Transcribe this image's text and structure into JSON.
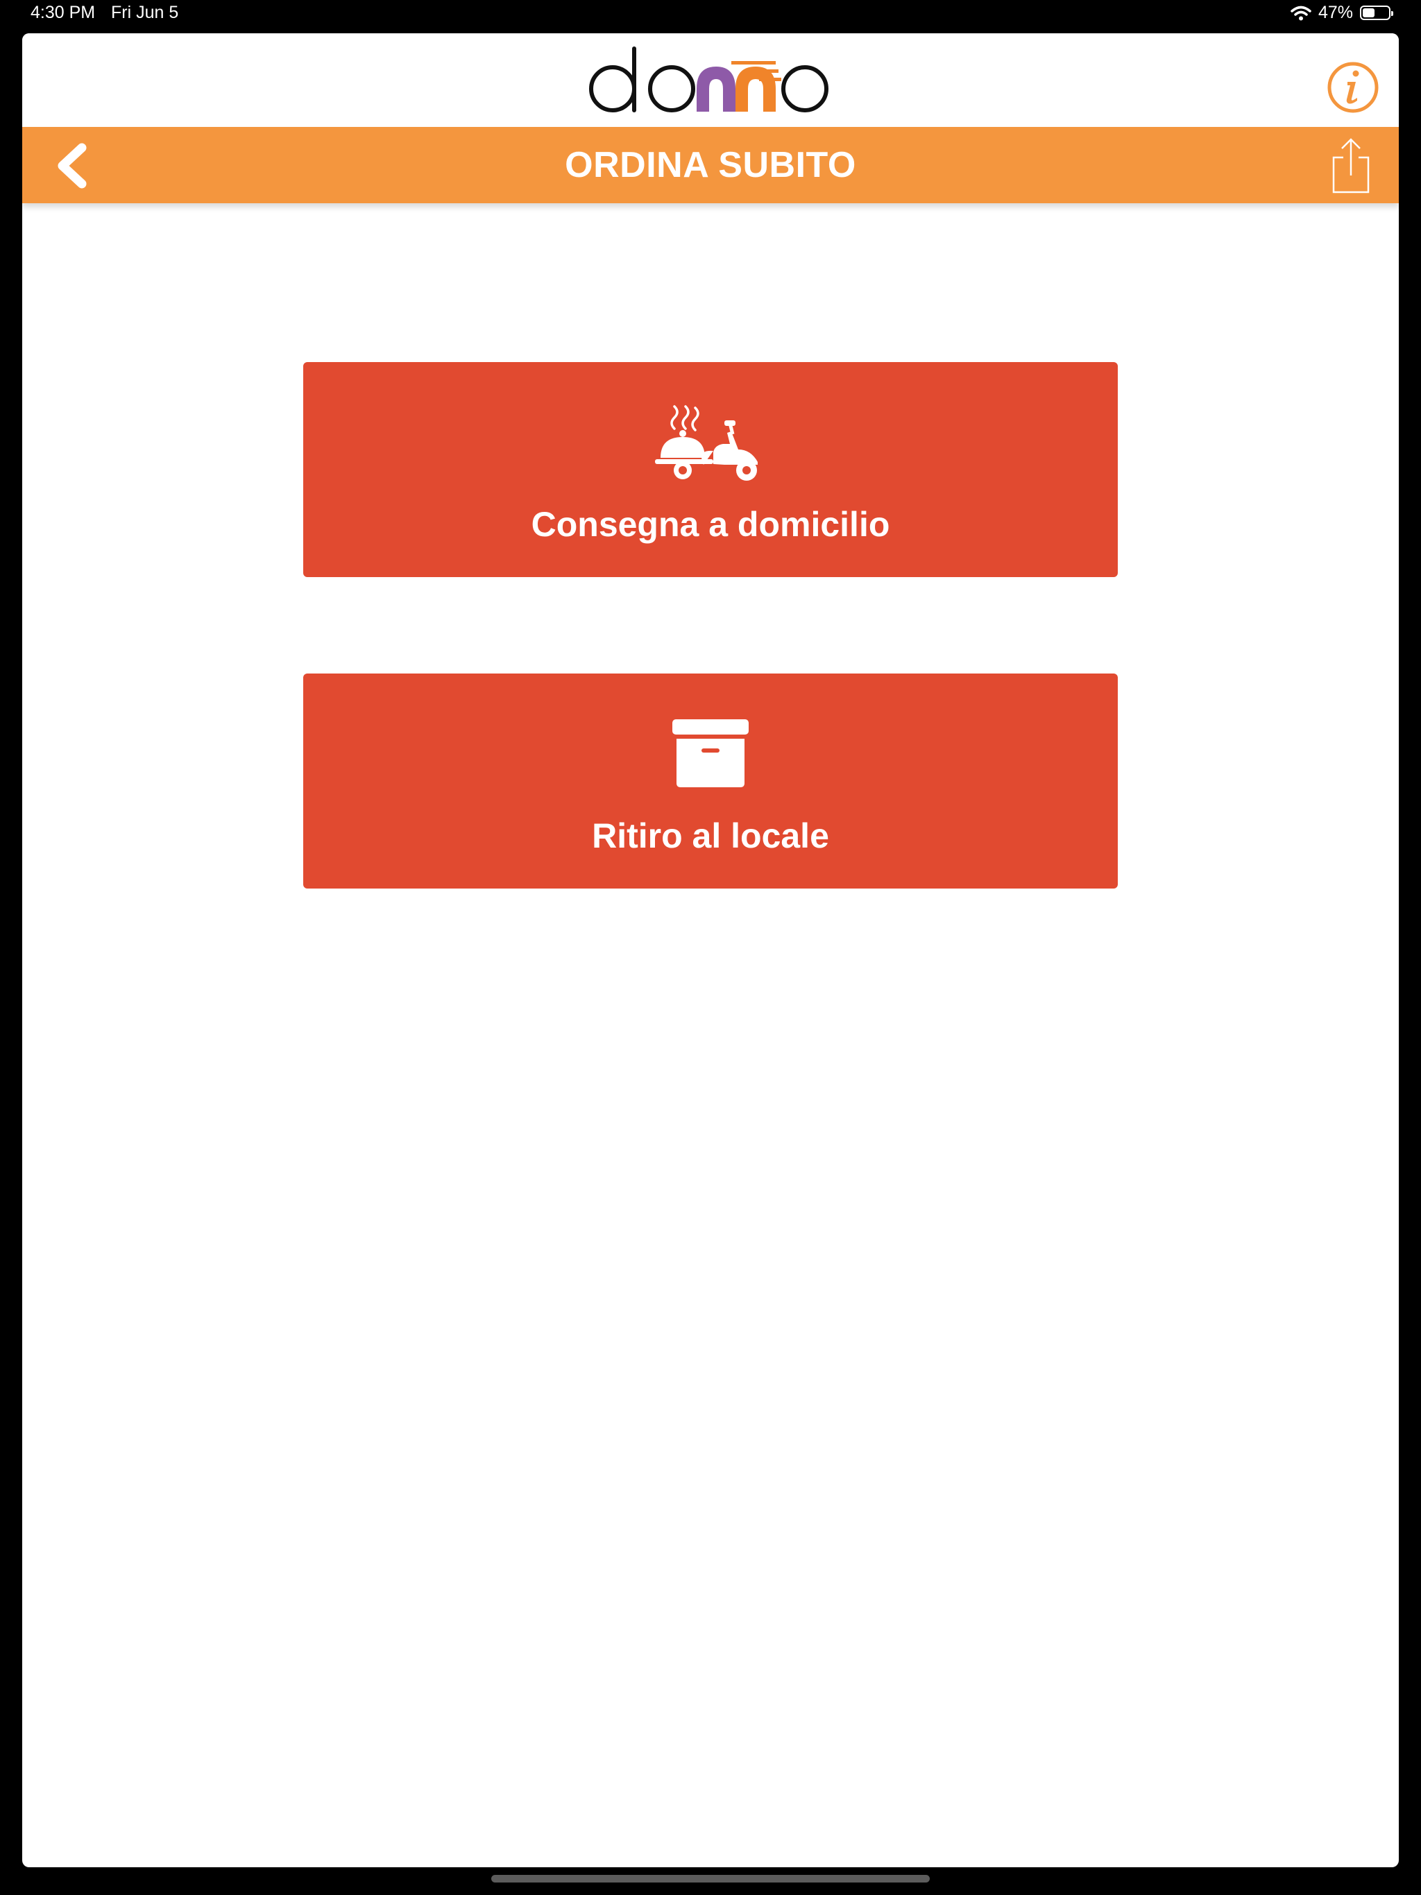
{
  "status_bar": {
    "time": "4:30 PM",
    "date": "Fri Jun 5",
    "battery": "47%",
    "battery_level": 0.47,
    "wifi_icon": "wifi-icon",
    "battery_icon": "battery-icon"
  },
  "header": {
    "logo_text": "domo",
    "info_icon": "info-circle-icon"
  },
  "navbar": {
    "title": "ORDINA SUBITO",
    "back_icon": "chevron-left-icon",
    "share_icon": "share-icon"
  },
  "options": [
    {
      "label": "Consegna a domicilio",
      "icon": "scooter-delivery-icon"
    },
    {
      "label": "Ritiro al locale",
      "icon": "archive-box-icon"
    }
  ],
  "colors": {
    "accent_orange": "#f4963e",
    "button_red": "#e14a30",
    "logo_purple": "#8e5aa8",
    "logo_orange": "#f0842a"
  }
}
